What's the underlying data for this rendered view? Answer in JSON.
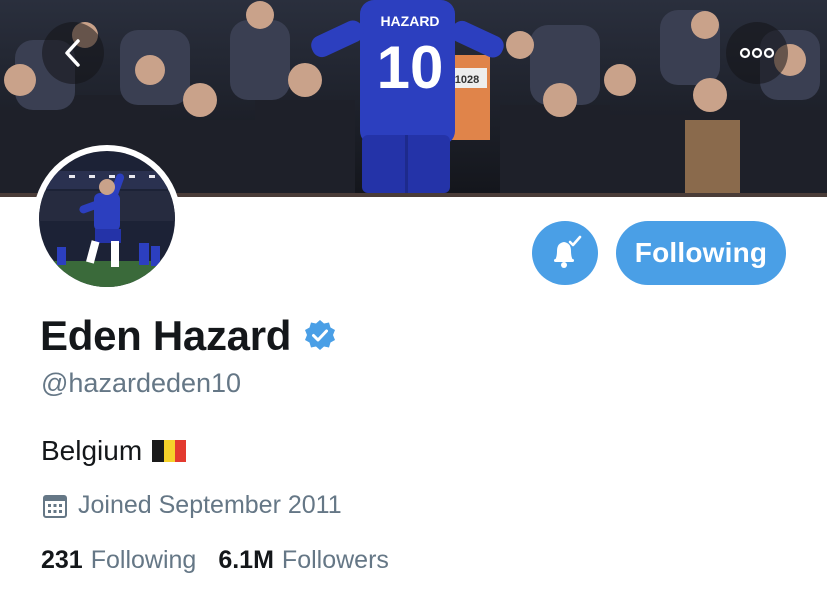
{
  "header": {
    "jersey_name": "HAZARD",
    "jersey_number": "10",
    "steward_tag": "1028"
  },
  "profile": {
    "name": "Eden Hazard",
    "handle": "@hazardeden10",
    "bio": "Belgium",
    "joined": "Joined September 2011",
    "following_count": "231",
    "following_label": "Following",
    "followers_count": "6.1M",
    "followers_label": "Followers"
  },
  "actions": {
    "follow_label": "Following"
  },
  "icons": {
    "back": "chevron-left-icon",
    "more": "more-dots-icon",
    "bell": "bell-check-icon",
    "verified": "verified-badge-icon",
    "calendar": "calendar-icon",
    "flag": "belgium-flag-icon"
  },
  "colors": {
    "accent": "#4a9fe6",
    "text_primary": "#14171a",
    "text_secondary": "#657786",
    "flag": [
      "#1b1b1b",
      "#f6d22a",
      "#e33a2f"
    ]
  }
}
